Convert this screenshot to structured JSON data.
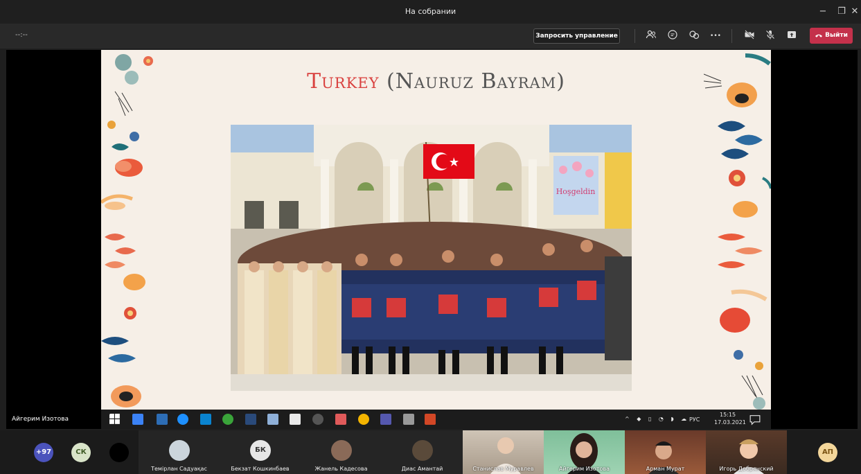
{
  "window": {
    "title": "На собрании",
    "minimize_glyph": "−",
    "maximize_glyph": "❐",
    "close_glyph": "✕"
  },
  "toolbar": {
    "timer": "--:--",
    "request_control_label": "Запросить управление",
    "leave_label": "Выйти",
    "more_glyph": "•••",
    "icons": [
      "people-icon",
      "chat-icon",
      "reactions-icon",
      "more-icon",
      "camera-off-icon",
      "mic-off-icon",
      "share-icon",
      "phone-icon"
    ]
  },
  "slide": {
    "title_accent": "Turkey",
    "title_rest": " (Nauruz Bayram)",
    "photo_sign": "Hoşgeldin"
  },
  "presenter": {
    "name": "Айгерим Изотова"
  },
  "taskbar": {
    "language": "РУС",
    "time": "15:15",
    "date": "17.03.2021"
  },
  "participants": {
    "overflow_count": "+97",
    "avatars": [
      {
        "initials": "СК",
        "bg": "#d9e4c9",
        "fg": "#3f5b26"
      },
      {
        "initials": "БК",
        "bg": "#e6e6e6",
        "fg": "#333333"
      },
      {
        "initials": "АП",
        "bg": "#f3d69a",
        "fg": "#7a5312"
      }
    ],
    "tiles": [
      {
        "name": "Темірлан Садуақас"
      },
      {
        "name": "Бекзат Кошкинбаев"
      },
      {
        "name": "Жанель Кадесова"
      },
      {
        "name": "Диас Амантай"
      },
      {
        "name": "Станислав Муравлев"
      },
      {
        "name": "Айгерим Изотова"
      },
      {
        "name": "Арман Мурат"
      },
      {
        "name": "Игорь Добрянский"
      }
    ]
  },
  "colors": {
    "accent_red": "#c4314b",
    "title_red": "#d9413f",
    "overflow_purple": "#4b53bc"
  }
}
